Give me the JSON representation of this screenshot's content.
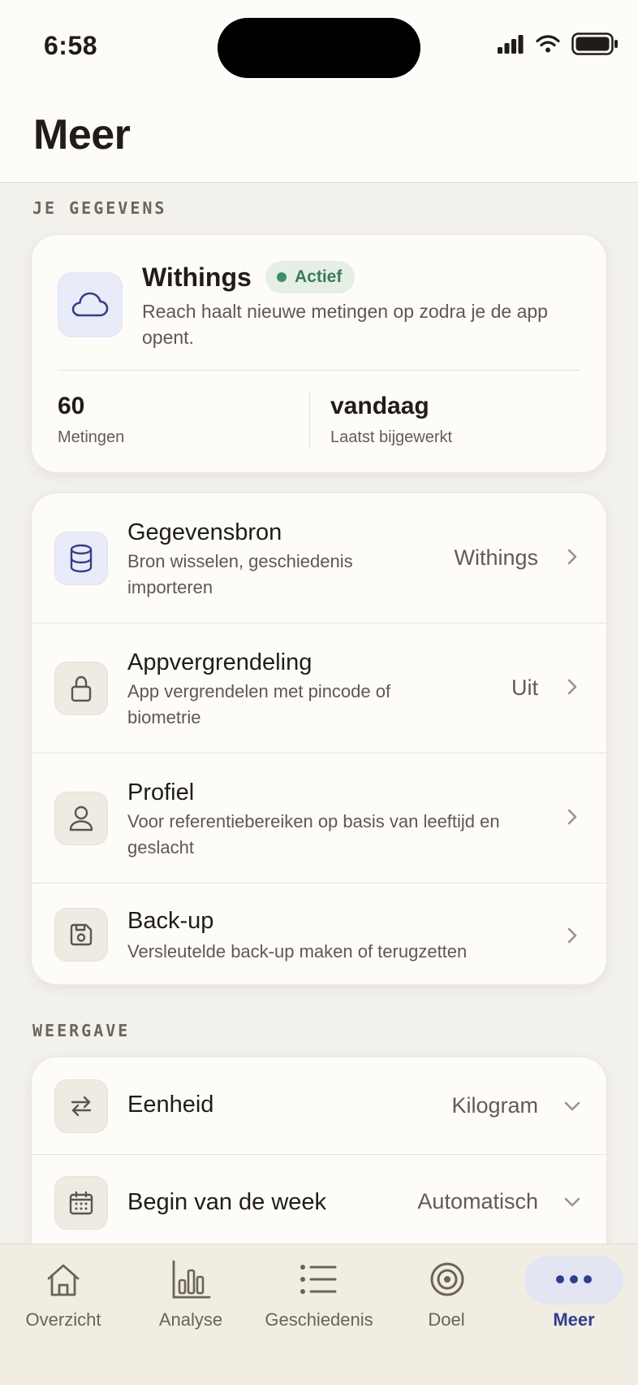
{
  "status_bar": {
    "time": "6:58"
  },
  "header": {
    "title": "Meer"
  },
  "section_data": {
    "label": "JE GEGEVENS"
  },
  "withings": {
    "title": "Withings",
    "badge": "Actief",
    "description": "Reach haalt nieuwe metingen op zodra je de app opent.",
    "stats": [
      {
        "value": "60",
        "label": "Metingen"
      },
      {
        "value": "vandaag",
        "label": "Laatst bijgewerkt"
      }
    ]
  },
  "settings": [
    {
      "title": "Gegevensbron",
      "subtitle": "Bron wisselen, geschiedenis importeren",
      "value": "Withings",
      "icon": "database-icon"
    },
    {
      "title": "Appvergrendeling",
      "subtitle": "App vergrendelen met pincode of biometrie",
      "value": "Uit",
      "icon": "lock-icon"
    },
    {
      "title": "Profiel",
      "subtitle": "Voor referentiebereiken op basis van leeftijd en geslacht",
      "value": "",
      "icon": "user-icon"
    },
    {
      "title": "Back-up",
      "subtitle": "Versleutelde back-up maken of terugzetten",
      "value": "",
      "icon": "save-icon"
    }
  ],
  "section_display": {
    "label": "WEERGAVE"
  },
  "display": [
    {
      "title": "Eenheid",
      "value": "Kilogram",
      "icon": "swap-icon"
    },
    {
      "title": "Begin van de week",
      "value": "Automatisch",
      "icon": "calendar-icon"
    }
  ],
  "tabbar": [
    {
      "label": "Overzicht",
      "icon": "home-icon"
    },
    {
      "label": "Analyse",
      "icon": "bar-chart-icon"
    },
    {
      "label": "Geschiedenis",
      "icon": "list-icon"
    },
    {
      "label": "Doel",
      "icon": "target-icon"
    },
    {
      "label": "Meer",
      "icon": "more-icon",
      "active": true
    }
  ],
  "colors": {
    "accent": "#2f3f8f",
    "active_badge": "#3c7a56",
    "background": "#f3f1ec",
    "card": "#fdfcf9"
  }
}
